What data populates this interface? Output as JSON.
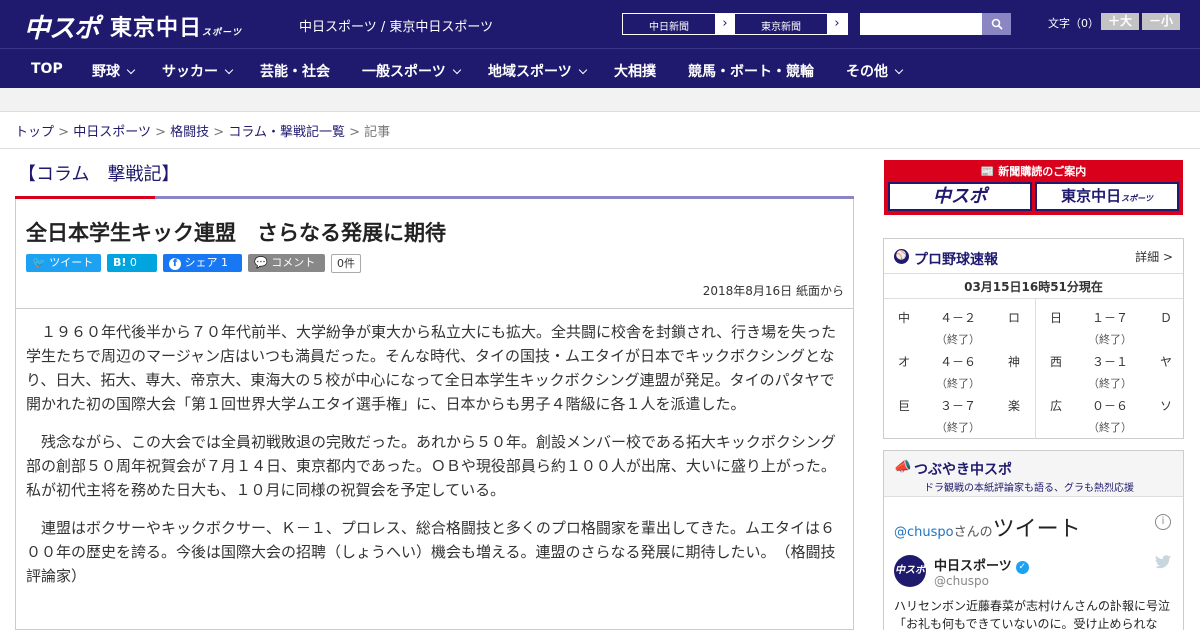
{
  "header": {
    "logo_primary": "中スポ",
    "logo_secondary": "東京中日",
    "logo_secondary_small": "スポーツ",
    "site_links": "中日スポーツ / 東京中日スポーツ",
    "paper_buttons": [
      {
        "label": "中日新聞",
        "arrow": "›"
      },
      {
        "label": "東京新聞",
        "arrow": "›"
      }
    ],
    "search_placeholder": "",
    "font_size_label": "文字（0）",
    "font_larger": "＋大",
    "font_smaller": "－小"
  },
  "nav": {
    "items": [
      {
        "label": "TOP",
        "dropdown": false
      },
      {
        "label": "野球",
        "dropdown": true
      },
      {
        "label": "サッカー",
        "dropdown": true
      },
      {
        "label": "芸能・社会",
        "dropdown": false
      },
      {
        "label": "一般スポーツ",
        "dropdown": true
      },
      {
        "label": "地域スポーツ",
        "dropdown": true
      },
      {
        "label": "大相撲",
        "dropdown": false
      },
      {
        "label": "競馬・ボート・競輪",
        "dropdown": false
      },
      {
        "label": "その他",
        "dropdown": true
      }
    ]
  },
  "breadcrumb": {
    "items": [
      "トップ",
      "中日スポーツ",
      "格闘技",
      "コラム・撃戦記一覧"
    ],
    "separator": ">",
    "current": "記事"
  },
  "article": {
    "column_heading": "【コラム　撃戦記】",
    "title": "全日本学生キック連盟　さらなる発展に期待",
    "share": {
      "tweet": "ツイート",
      "hatena": "B!",
      "hatena_count": "0",
      "facebook": "シェア",
      "facebook_count": "1",
      "comment": "コメント",
      "comment_count": "0件"
    },
    "dateline": "2018年8月16日 紙面から",
    "paragraphs": [
      "１９６０年代後半から７０年代前半、大学紛争が東大から私立大にも拡大。全共闘に校舎を封鎖され、行き場を失った学生たちで周辺のマージャン店はいつも満員だった。そんな時代、タイの国技・ムエタイが日本でキックボクシングとなり、日大、拓大、専大、帝京大、東海大の５校が中心になって全日本学生キックボクシング連盟が発足。タイのパタヤで開かれた初の国際大会「第１回世界大学ムエタイ選手権」に、日本からも男子４階級に各１人を派遣した。",
      "残念ながら、この大会では全員初戦敗退の完敗だった。あれから５０年。創設メンバー校である拓大キックボクシング部の創部５０周年祝賀会が７月１４日、東京都内であった。ＯＢや現役部員ら約１００人が出席、大いに盛り上がった。私が初代主将を務めた日大も、１０月に同様の祝賀会を予定している。",
      "連盟はボクサーやキックボクサー、Ｋ－１、プロレス、総合格闘技と多くのプロ格闘家を輩出してきた。ムエタイは６００年の歴史を誇る。今後は国際大会の招聘（しょうへい）機会も増える。連盟のさらなる発展に期待したい。　（格闘技評論家）"
    ]
  },
  "sidebar": {
    "subscribe": {
      "heading": "新聞購読のご案内",
      "logo_a": "中スポ",
      "logo_b": "東京中日",
      "logo_b_small": "スポーツ"
    },
    "baseball": {
      "title": "プロ野球速報",
      "detail": "詳細 >",
      "timestamp": "03月15日16時51分現在",
      "games": [
        {
          "team1": "中",
          "score": "４－２",
          "team2": "ロ",
          "status": "（終了）"
        },
        {
          "team1": "日",
          "score": "１－７",
          "team2": "Ｄ",
          "status": "（終了）"
        },
        {
          "team1": "オ",
          "score": "４－６",
          "team2": "神",
          "status": "（終了）"
        },
        {
          "team1": "西",
          "score": "３－１",
          "team2": "ヤ",
          "status": "（終了）"
        },
        {
          "team1": "巨",
          "score": "３－７",
          "team2": "楽",
          "status": "（終了）"
        },
        {
          "team1": "広",
          "score": "０－６",
          "team2": "ソ",
          "status": "（終了）"
        }
      ]
    },
    "tweets": {
      "title": "つぶやき中スポ",
      "subtitle": "ドラ観戦の本紙評論家も語る、グラも熱烈応援",
      "by_handle": "@chuspo",
      "by_suffix": "さんの",
      "by_big": "ツイート",
      "account_name": "中日スポーツ",
      "account_handle": "@chuspo",
      "avatar_text": "中スポ",
      "tweet_text": "ハリセンボン近藤春菜が志村けんさんの訃報に号泣「お礼も何もできていないのに。受け止められな"
    }
  },
  "colors": {
    "brand_navy": "#1f1a6e",
    "accent_red": "#d9001b",
    "accent_lavender": "#8a86c4",
    "twitter": "#1da1f2",
    "facebook": "#1877f2",
    "hatena": "#00a4de"
  }
}
